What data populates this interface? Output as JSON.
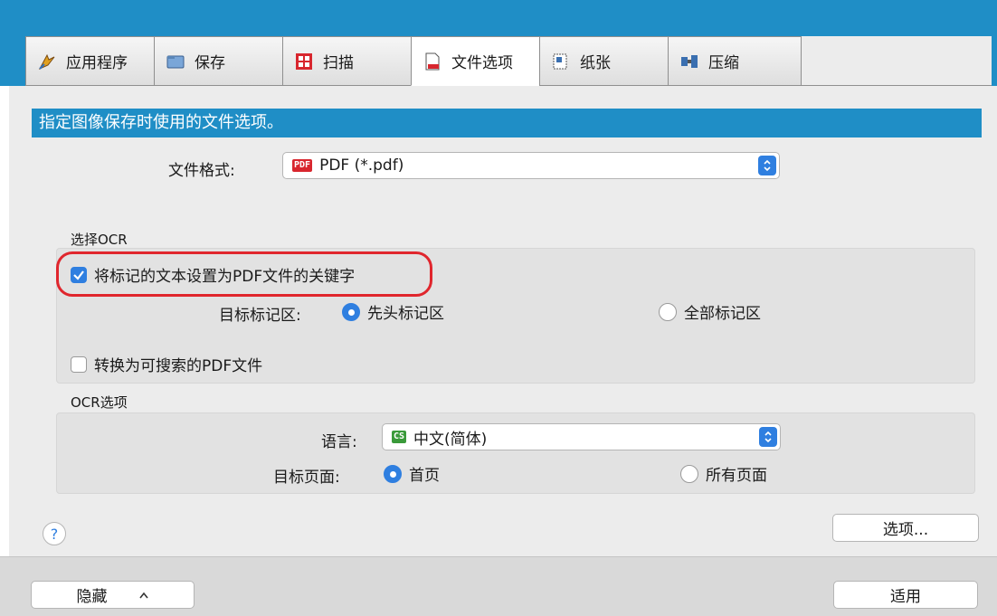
{
  "tabs": [
    {
      "label": "应用程序",
      "icon": "pen-icon"
    },
    {
      "label": "保存",
      "icon": "folder-icon"
    },
    {
      "label": "扫描",
      "icon": "scan-icon"
    },
    {
      "label": "文件选项",
      "icon": "file-icon"
    },
    {
      "label": "纸张",
      "icon": "paper-icon"
    },
    {
      "label": "压缩",
      "icon": "compress-icon"
    }
  ],
  "active_tab": "文件选项",
  "heading": "指定图像保存时使用的文件选项。",
  "file_format": {
    "label": "文件格式:",
    "badge": "PDF",
    "value": "PDF (*.pdf)"
  },
  "ocr_select": {
    "section_label": "选择OCR",
    "keyword_checkbox": {
      "label": "将标记的文本设置为PDF文件的关键字",
      "checked": true
    },
    "target_label": "目标标记区:",
    "target_options": [
      {
        "label": "先头标记区",
        "selected": true
      },
      {
        "label": "全部标记区",
        "selected": false
      }
    ],
    "searchable_checkbox": {
      "label": "转换为可搜索的PDF文件",
      "checked": false
    }
  },
  "ocr_options": {
    "section_label": "OCR选项",
    "language_label": "语言:",
    "language_badge": "CS",
    "language_value": "中文(简体)",
    "pages_label": "目标页面:",
    "pages_options": [
      {
        "label": "首页",
        "selected": true
      },
      {
        "label": "所有页面",
        "selected": false
      }
    ]
  },
  "buttons": {
    "options": "选项...",
    "hide": "隐藏",
    "apply": "适用",
    "help": "?"
  },
  "colors": {
    "accent_blue": "#1f8ec6",
    "control_blue": "#2f7fe0",
    "highlight_red": "#e0262d"
  }
}
